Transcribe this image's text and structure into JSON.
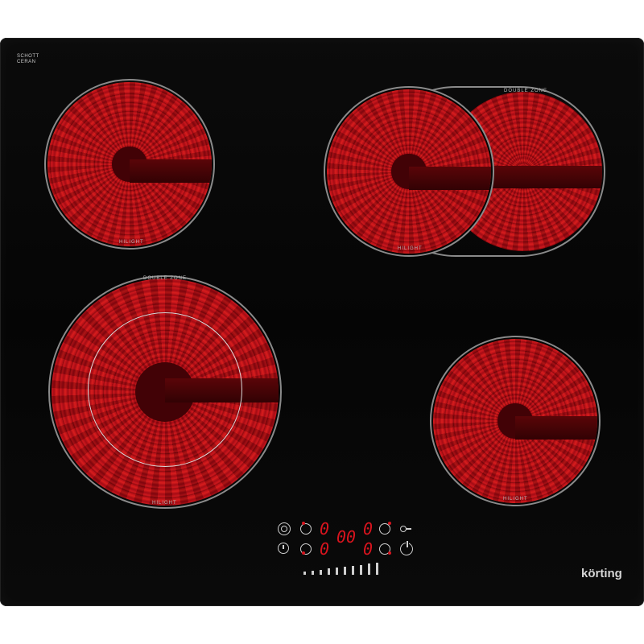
{
  "brand": {
    "name": "körting",
    "glass_maker_line1": "SCHOTT",
    "glass_maker_line2": "CERAN"
  },
  "zones": [
    {
      "id": "rear-left",
      "label": "HILIGHT"
    },
    {
      "id": "rear-right",
      "label": "HILIGHT",
      "extension_label": "DOUBLE ZONE"
    },
    {
      "id": "front-left",
      "label": "HILIGHT",
      "extension_label": "DOUBLE ZONE"
    },
    {
      "id": "front-right",
      "label": "HILIGHT"
    }
  ],
  "display": {
    "rear_left_level": "0",
    "timer": "00",
    "rear_right_level": "0",
    "front_left_level": "0",
    "front_right_level": "0"
  },
  "controls": {
    "icons": [
      "double-zone-icon",
      "timer-clock-icon",
      "lock-key-icon",
      "power-icon",
      "zone-select-icon"
    ],
    "slider_levels": 10
  },
  "colors": {
    "glass": "#050505",
    "heating": "#c8141a",
    "display": "#d8141e",
    "print": "#cfcfcf"
  }
}
